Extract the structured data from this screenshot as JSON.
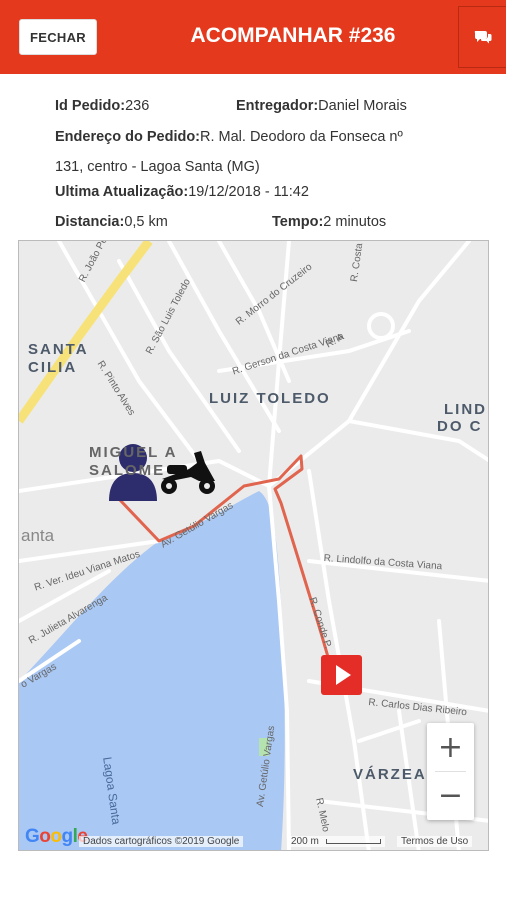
{
  "header": {
    "close_label": "FECHAR",
    "title": "ACOMPANHAR #236",
    "chat_icon": "chat-icon",
    "color": "#e4391c"
  },
  "order": {
    "id_label": "Id Pedido:",
    "id_value": "236",
    "courier_label": "Entregador:",
    "courier_value": "Daniel Morais",
    "address_label": "Endereço do Pedido:",
    "address_line1": "R. Mal. Deodoro da Fonseca nº",
    "address_line2": "131, centro - Lagoa Santa (MG)",
    "updated_label": "Ultima Atualização:",
    "updated_value": "19/12/2018 - 11:42",
    "distance_label": "Distancia:",
    "distance_value": "0,5 km",
    "time_label": "Tempo:",
    "time_value": "2 minutos"
  },
  "map": {
    "areas": {
      "santa_cilia_1": "SANTA",
      "santa_cilia_2": "CILIA",
      "luiz_toledo": "LUIZ TOLEDO",
      "lindo_1": "LIND",
      "lindo_2": "DO C",
      "miguel": "MIGUEL A",
      "salome": "SALOME",
      "varzea": "VÁRZEA",
      "anta": "anta",
      "lagoa": "Lagoa Santa"
    },
    "streets": {
      "joao_pereira": "R. João Pereira",
      "sao_luis": "R. São Luis Toledo",
      "pinto_alves": "R. Pinto Alves",
      "morro_cruzeiro": "R. Morro do Cruzeiro",
      "gerson": "R. Gerson da Costa Viana",
      "r_a": "R. A",
      "costa_viana": "R. Costa Viana",
      "gebulio_1": "Av. Getúlio Vargas",
      "ideu": "R. Ver. Ideu Viana Matos",
      "julieta": "R. Julieta Alvarenga",
      "vargas_left": "o Vargas",
      "lindolfo": "R. Lindolfo da Costa Viana",
      "conde": "R. Conde P.",
      "carlos": "R. Carlos Dias Ribeiro",
      "gebulio_2": "Av. Getúlio Vargas",
      "melo": "R. Melo"
    },
    "zoom_in": "+",
    "zoom_out": "−",
    "attribution": "Dados cartográficos ©2019 Google",
    "scale": "200 m",
    "terms": "Termos de Uso",
    "logo": "Google",
    "santa_tag": "anta",
    "route_color": "#e0644e",
    "water_color": "#a9c8f4",
    "yellow_road": "#f7e27a",
    "icons": {
      "customer": "person-icon",
      "courier": "motorcycle-icon",
      "destination": "play-marker-icon"
    }
  }
}
